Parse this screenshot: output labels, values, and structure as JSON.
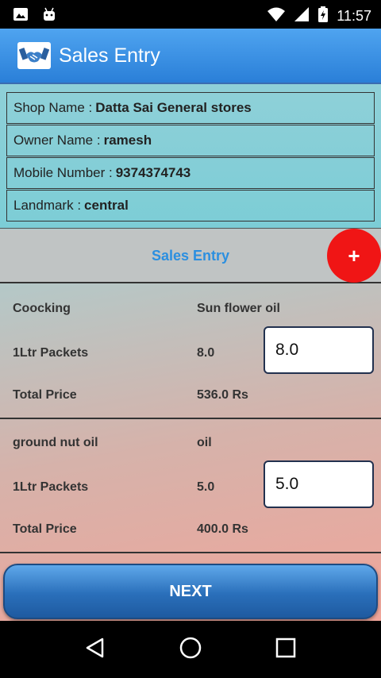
{
  "status_bar": {
    "time": "11:57",
    "icons_left": [
      "image-icon",
      "android-icon"
    ],
    "icons_right": [
      "wifi-icon",
      "signal-icon",
      "battery-charging-icon"
    ]
  },
  "app_bar": {
    "title": "Sales Entry",
    "logo": "handshake-icon"
  },
  "shop": {
    "shop_name_label": "Shop Name :",
    "shop_name_value": "Datta Sai General stores",
    "owner_name_label": "Owner Name :",
    "owner_name_value": "ramesh",
    "mobile_label": "Mobile Number :",
    "mobile_value": "9374374743",
    "landmark_label": "Landmark :",
    "landmark_value": "central"
  },
  "sales_header": {
    "label": "Sales Entry",
    "add_button": "+"
  },
  "entries": [
    {
      "category": "Coocking",
      "product": "Sun flower oil",
      "packet_label": "1Ltr Packets",
      "packet_count": "8.0",
      "input_value": "8.0",
      "total_label": "Total Price",
      "total_value": "536.0 Rs"
    },
    {
      "category": "ground nut oil",
      "product": "oil",
      "packet_label": "1Ltr Packets",
      "packet_count": "5.0",
      "input_value": "5.0",
      "total_label": "Total Price",
      "total_value": "400.0 Rs"
    }
  ],
  "next_button": "NEXT",
  "nav_bar": {
    "icons": [
      "back-icon",
      "home-icon",
      "recents-icon"
    ]
  },
  "colors": {
    "app_bar": "#2a7fd8",
    "accent_text": "#2b8fe0",
    "fab": "#f01515",
    "next_button": "#2a6fba"
  }
}
